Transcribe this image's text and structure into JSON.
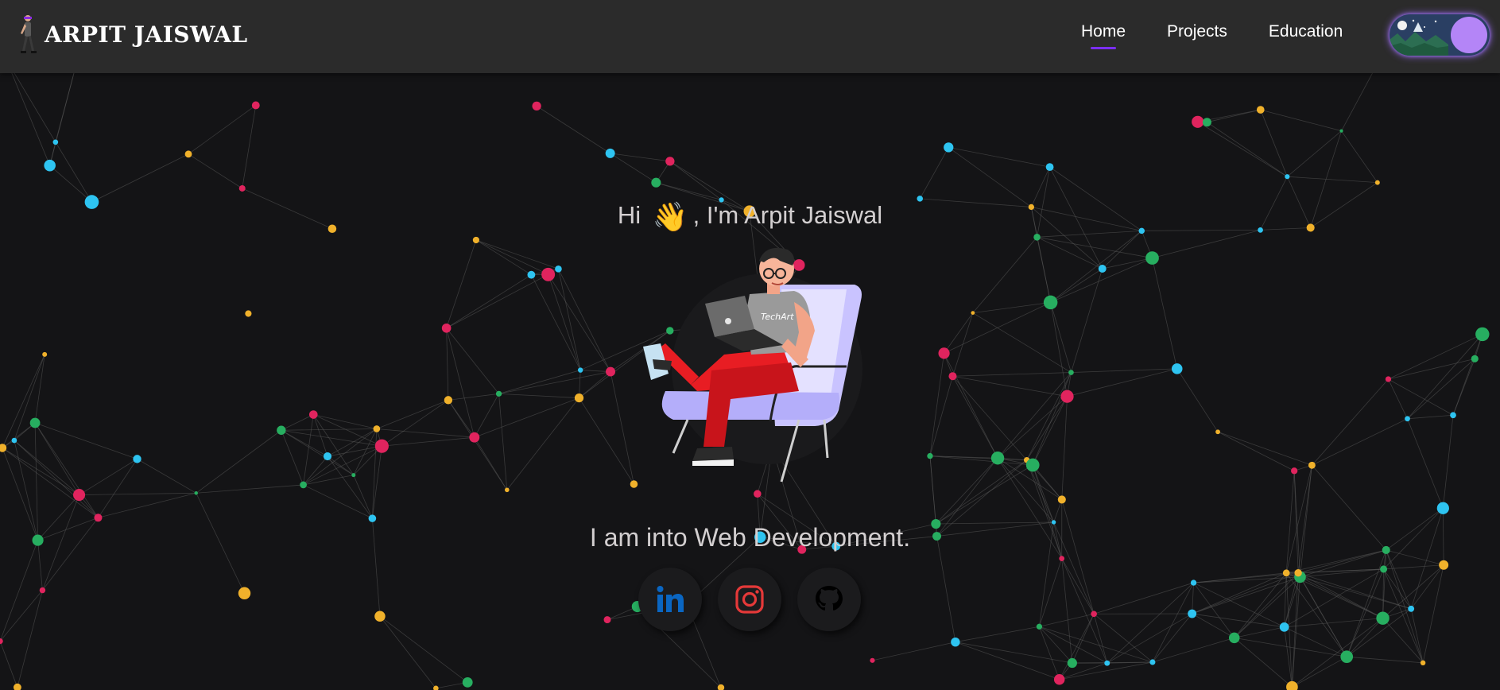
{
  "header": {
    "brand_name": "ARPIT JAISWAL",
    "nav_items": [
      {
        "label": "Home",
        "active": true
      },
      {
        "label": "Projects",
        "active": false
      },
      {
        "label": "Education",
        "active": false
      }
    ],
    "theme_toggle": {
      "state": "dark",
      "knob_color": "#b485f7"
    }
  },
  "hero": {
    "greeting_prefix": "Hi",
    "greeting_emoji": "👋",
    "greeting_suffix": ", I'm Arpit Jaiswal",
    "laptop_sticker": "TechArt",
    "tagline": "I am into Web Development."
  },
  "socials": [
    {
      "name": "linkedin",
      "icon": "linkedin-icon",
      "color": "#0a66c2"
    },
    {
      "name": "instagram",
      "icon": "instagram-icon",
      "color": "#e1306c"
    },
    {
      "name": "github",
      "icon": "github-icon",
      "color": "#000000"
    }
  ],
  "colors": {
    "background": "#141416",
    "navbar": "#2b2b2b",
    "accent": "#7b2ff7",
    "particle_colors": [
      "#2ec4f1",
      "#f0b12b",
      "#e0245e",
      "#27ae60"
    ]
  }
}
